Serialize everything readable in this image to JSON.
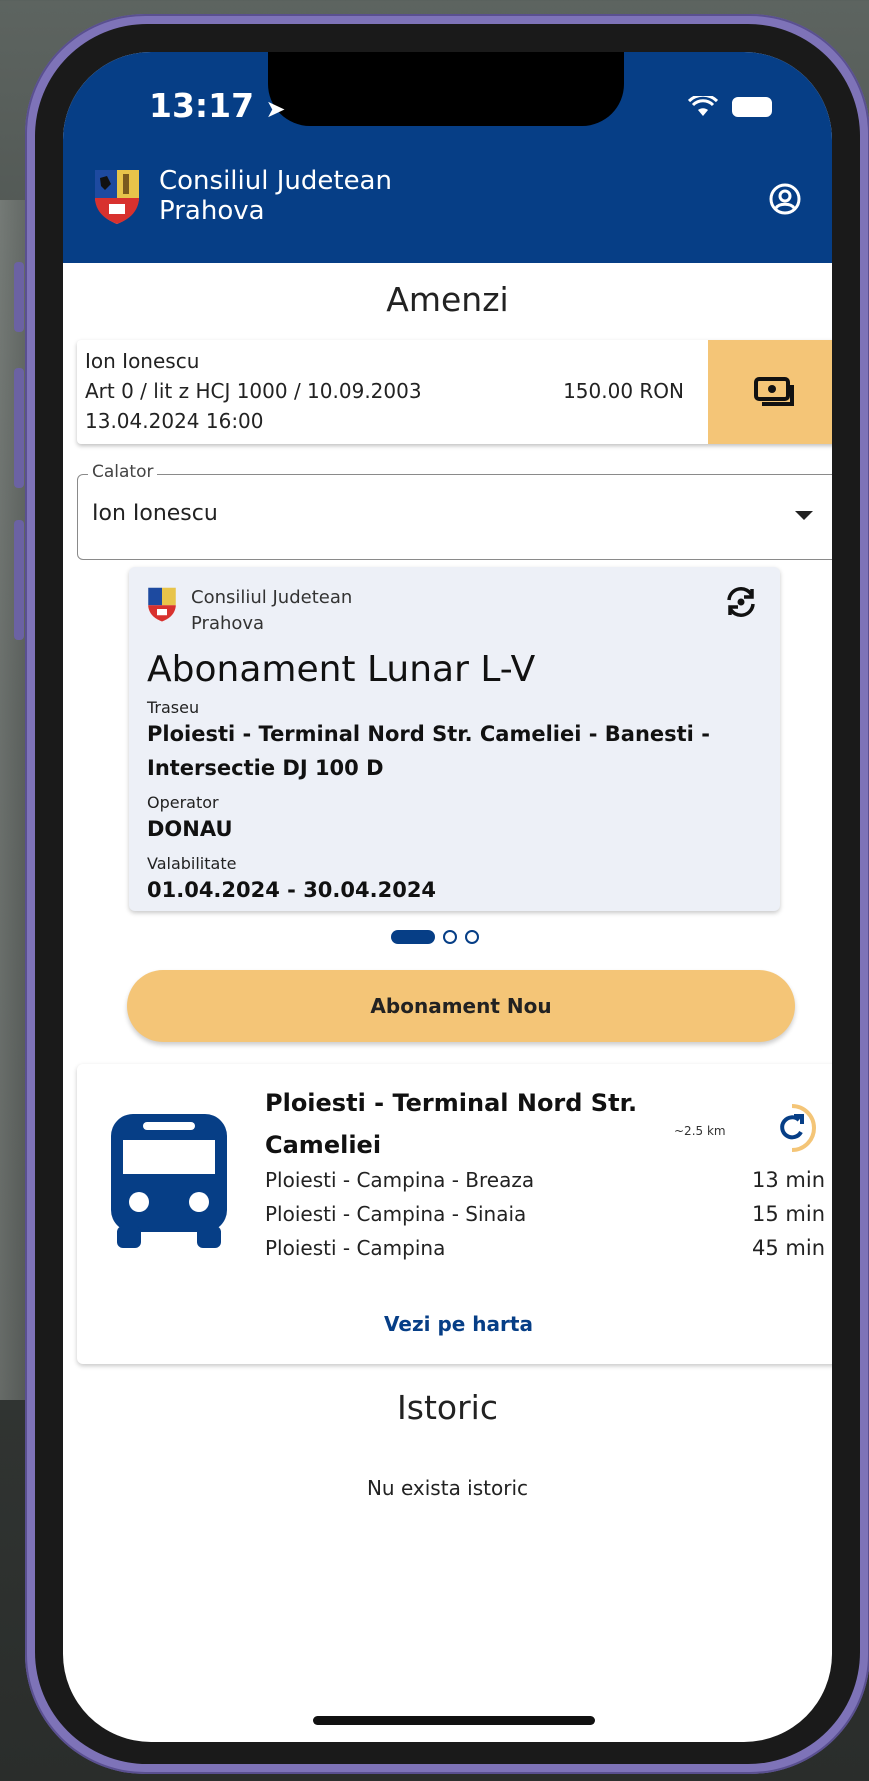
{
  "status_bar": {
    "time": "13:17"
  },
  "header": {
    "brand_line1": "Consiliul Judetean",
    "brand_line2": "Prahova",
    "accent_color": "#063e86"
  },
  "fines": {
    "title": "Amenzi",
    "item": {
      "name": "Ion Ionescu",
      "article": "Art 0 / lit z HCJ 1000 / 10.09.2003",
      "amount": "150.00 RON",
      "datetime": "13.04.2024 16:00"
    },
    "pay_icon": "cash-payment-icon"
  },
  "traveler_select": {
    "label": "Calator",
    "value": "Ion Ionescu"
  },
  "subscription": {
    "brand_line1": "Consiliul Judetean",
    "brand_line2": "Prahova",
    "title": "Abonament Lunar L-V",
    "route_label": "Traseu",
    "route_line1": "Ploiesti - Terminal Nord Str. Cameliei - Banesti -",
    "route_line2": "Intersectie DJ 100 D",
    "operator_label": "Operator",
    "operator": "DONAU",
    "validity_label": "Valabilitate",
    "validity": "01.04.2024 - 30.04.2024",
    "carousel_pages": 3,
    "carousel_active": 1
  },
  "new_subscription_button": "Abonament Nou",
  "station": {
    "name_line1": "Ploiesti - Terminal Nord Str.",
    "name_line2": "Cameliei",
    "distance": "~2.5 km",
    "routes": [
      {
        "name": "Ploiesti - Campina - Breaza",
        "eta": "13 min"
      },
      {
        "name": "Ploiesti - Campina - Sinaia",
        "eta": "15 min"
      },
      {
        "name": "Ploiesti - Campina",
        "eta": "45 min"
      }
    ],
    "map_link": "Vezi pe harta"
  },
  "history": {
    "title": "Istoric",
    "empty_text": "Nu exista istoric"
  },
  "colors": {
    "primary": "#063e86",
    "accent": "#f4c577",
    "card_bg": "#edf0f7"
  }
}
